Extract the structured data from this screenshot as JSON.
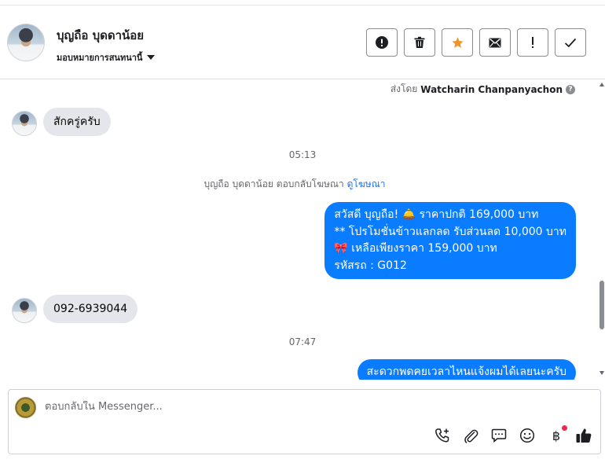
{
  "header": {
    "name": "บุญถือ บุดดาน้อย",
    "assign_label": "มอบหมายการสนทนานี้"
  },
  "toolbar": {
    "spam_icon": "alert-circle-icon",
    "delete_icon": "trash-icon",
    "star_icon": "star-icon",
    "unread_icon": "envelope-icon",
    "follow_up_icon": "exclamation-icon",
    "done_icon": "check-icon",
    "star_color": "#f0932b"
  },
  "chat": {
    "sent_by_prefix": "ส่งโดย",
    "sent_by_name": "Watcharin Chanpanyachon",
    "messages": [
      {
        "text": "สักครู่ครับ"
      },
      {
        "text": "092-6939044"
      }
    ],
    "timestamps": [
      "05:13",
      "07:47"
    ],
    "ad_reply_text": "บุญถือ บุดดาน้อย ตอบกลับโฆษณา",
    "ad_reply_link": "ดูโฆษณา",
    "outgoing": [
      {
        "lines": [
          "สวัสดี บุญถือ! 🛎️ ราคาปกติ 169,000 บาท",
          "** โปรโมชั่นข้าวแลกลด รับส่วนลด 10,000 บาท",
          "🎀  เหลือเพียงราคา 159,000 บาท",
          " รหัสรถ : G012"
        ]
      },
      {
        "lines": [
          "สะดวกพดคยเวลาไหนแจ้งผมได้เลยนะครับ"
        ]
      }
    ],
    "bubble_color": "#0a7cff"
  },
  "composer": {
    "placeholder": "ตอบกลับใน Messenger...",
    "tools": [
      "phone-plus-icon",
      "paperclip-icon",
      "chat-bubble-icon",
      "smiley-icon",
      "baht-icon",
      "thumbs-up-icon"
    ],
    "baht_symbol": "฿"
  }
}
